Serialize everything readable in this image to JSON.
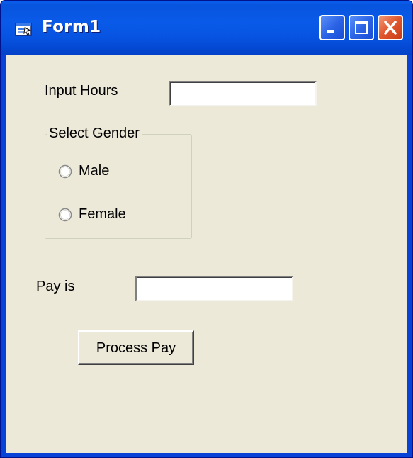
{
  "window": {
    "title": "Form1",
    "icons": {
      "app": "form-app-icon",
      "minimize": "minimize-icon",
      "maximize": "maximize-icon",
      "close": "close-icon"
    },
    "colors": {
      "titlebar": "#0a5ae9",
      "client": "#ece9d8",
      "close_button": "#e0562c"
    }
  },
  "form": {
    "hours_label": "Input Hours",
    "hours_value": "",
    "gender_group_title": "Select Gender",
    "gender_options": [
      {
        "label": "Male",
        "selected": false
      },
      {
        "label": "Female",
        "selected": false
      }
    ],
    "pay_label": "Pay is",
    "pay_value": "",
    "process_button_label": "Process Pay"
  }
}
